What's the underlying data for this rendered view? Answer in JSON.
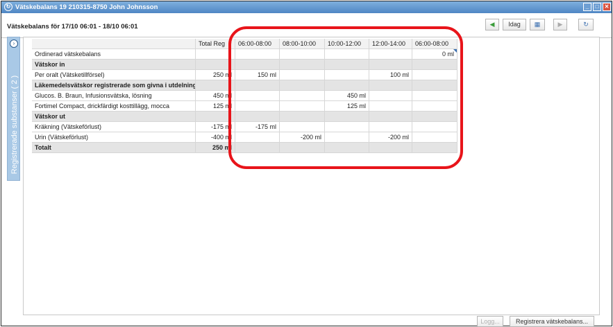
{
  "window": {
    "title": "Vätskebalans 19 210315-8750 John Johnsson",
    "min_label": "_",
    "max_label": "□",
    "close_label": "✕"
  },
  "header": {
    "title": "Vätskebalans för 17/10 06:01 - 18/10 06:01",
    "today_label": "Idag",
    "prev_icon": "arrow-left-icon",
    "calendar_icon": "calendar-icon",
    "next_icon": "arrow-right-icon",
    "refresh_icon": "refresh-icon"
  },
  "sidepanel": {
    "label": "Registrerade substanser ( 2 )"
  },
  "table": {
    "columns": [
      "",
      "Total Reg",
      "06:00-08:00",
      "08:00-10:00",
      "10:00-12:00",
      "12:00-14:00",
      "06:00-08:00"
    ],
    "rows": [
      {
        "type": "data",
        "cells": [
          "Ordinerad vätskebalans",
          "",
          "",
          "",
          "",
          "",
          "0 ml"
        ]
      },
      {
        "type": "section",
        "cells": [
          "Vätskor in",
          "",
          "",
          "",
          "",
          "",
          ""
        ]
      },
      {
        "type": "data",
        "cells": [
          "Per oralt (Vätsketillförsel)",
          "250 ml",
          "150 ml",
          "",
          "",
          "100 ml",
          ""
        ]
      },
      {
        "type": "section",
        "cells": [
          "Läkemedelsvätskor registrerade som givna i utdelningsvyn",
          "",
          "",
          "",
          "",
          "",
          ""
        ]
      },
      {
        "type": "data",
        "cells": [
          "Glucos. B. Braun, Infusionsvätska, lösning",
          "450 ml",
          "",
          "",
          "450 ml",
          "",
          ""
        ]
      },
      {
        "type": "data",
        "cells": [
          "Fortimel Compact, drickfärdigt kosttillägg, mocca",
          "125 ml",
          "",
          "",
          "125 ml",
          "",
          ""
        ]
      },
      {
        "type": "section",
        "cells": [
          "Vätskor ut",
          "",
          "",
          "",
          "",
          "",
          ""
        ]
      },
      {
        "type": "data",
        "cells": [
          "Kräkning (Vätskeförlust)",
          "-175 ml",
          "-175 ml",
          "",
          "",
          "",
          ""
        ]
      },
      {
        "type": "data",
        "cells": [
          "Urin (Vätskeförlust)",
          "-400 ml",
          "",
          "-200 ml",
          "",
          "-200 ml",
          ""
        ]
      },
      {
        "type": "total",
        "cells": [
          "Totalt",
          "250 ml",
          "",
          "",
          "",
          "",
          ""
        ]
      }
    ]
  },
  "footer": {
    "logg_label": "Logg...",
    "register_label": "Registrera vätskebalans..."
  },
  "colors": {
    "titlebar": "#4f86c4",
    "sidepanel": "#a9c9e6",
    "highlight": "#e8141a"
  }
}
